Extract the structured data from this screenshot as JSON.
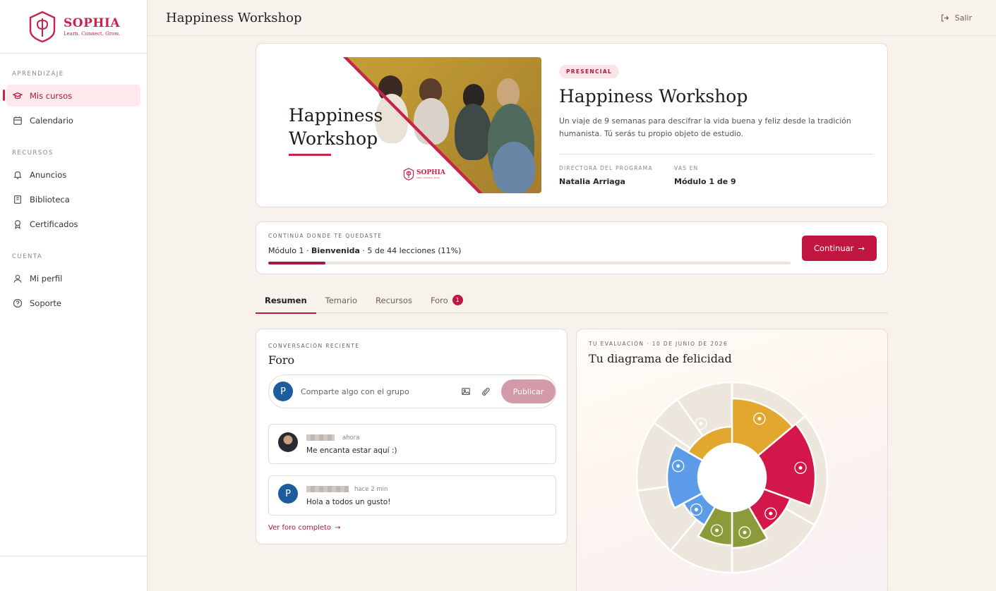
{
  "sidebar": {
    "brand": "SOPHIA",
    "tagline": "Learn. Connect. Grow.",
    "sections": [
      {
        "heading": "APRENDIZAJE",
        "items": [
          {
            "label": "Mis cursos",
            "icon": "graduation-cap-icon",
            "active": true
          },
          {
            "label": "Calendario",
            "icon": "calendar-icon",
            "active": false
          }
        ]
      },
      {
        "heading": "RECURSOS",
        "items": [
          {
            "label": "Anuncios",
            "icon": "bell-icon",
            "active": false
          },
          {
            "label": "Biblioteca",
            "icon": "book-icon",
            "active": false
          },
          {
            "label": "Certificados",
            "icon": "award-icon",
            "active": false
          }
        ]
      },
      {
        "heading": "CUENTA",
        "items": [
          {
            "label": "Mi perfil",
            "icon": "user-icon",
            "active": false
          },
          {
            "label": "Soporte",
            "icon": "help-circle-icon",
            "active": false
          }
        ]
      }
    ]
  },
  "topbar": {
    "title": "Happiness Workshop",
    "logout_label": "Salir"
  },
  "course": {
    "image_title_line1": "Happiness",
    "image_title_line2": "Workshop",
    "image_brand": "SOPHIA",
    "image_tagline": "Learn. Connect. Grow.",
    "badge": "PRESENCIAL",
    "title": "Happiness Workshop",
    "description": "Un viaje de 9 semanas para descifrar la vida buena y feliz desde la tradición humanista. Tú serás tu propio objeto de estudio.",
    "director_label": "DIRECTORA DEL PROGRAMA",
    "director_value": "Natalia Arriaga",
    "progress_label": "VAS EN",
    "progress_value": "Módulo 1 de 9"
  },
  "continue": {
    "label": "CONTINÚA DONDE TE QUEDASTE",
    "module": "Módulo 1 · ",
    "lesson": "Bienvenida",
    "detail": " · 5 de 44 lecciones (11%)",
    "progress_percent": 11,
    "button_label": "Continuar"
  },
  "tabs": [
    {
      "label": "Resumen",
      "active": true,
      "count": null
    },
    {
      "label": "Temario",
      "active": false,
      "count": null
    },
    {
      "label": "Recursos",
      "active": false,
      "count": null
    },
    {
      "label": "Foro",
      "active": false,
      "count": "1"
    }
  ],
  "forum": {
    "section_label": "CONVERSACIÓN RECIENTE",
    "title": "Foro",
    "composer_avatar": "P",
    "composer_placeholder": "Comparte algo con el grupo",
    "publish_label": "Publicar",
    "posts": [
      {
        "avatar": "photo",
        "time": "ahora",
        "message": "Me encanta estar aquí :)"
      },
      {
        "avatar": "P",
        "time": "hace 2 min",
        "message": "Hola a todos un gusto!"
      }
    ],
    "view_all": "Ver foro completo"
  },
  "happiness": {
    "section_label": "TU EVALUACIÓN · 10 DE JUNIO DE 2026",
    "title": "Tu diagrama de felicidad",
    "colors": {
      "gold": "#E2A72E",
      "red": "#D4174A",
      "blue": "#5B9BE8",
      "olive": "#8C9A3A",
      "track": "#ECE6DD"
    }
  },
  "colors": {
    "accent": "#C0163F",
    "background": "#F7F2EC"
  }
}
